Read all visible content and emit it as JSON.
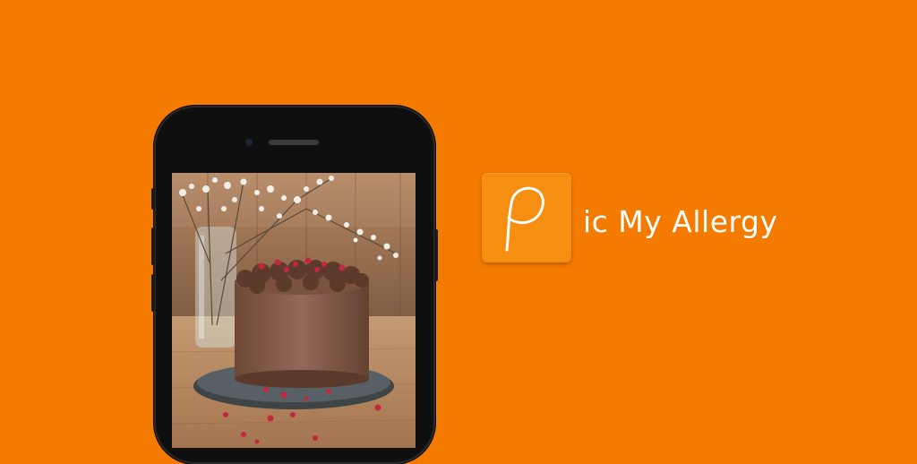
{
  "brand": {
    "name": "ic My Allergy",
    "logo_icon": "letter-p-logo-icon",
    "background_color": "#f57a00",
    "logo_color": "#f68e12"
  },
  "phone": {
    "screen_image": "chocolate-cake-photo",
    "device_color": "#0f0f0f"
  }
}
